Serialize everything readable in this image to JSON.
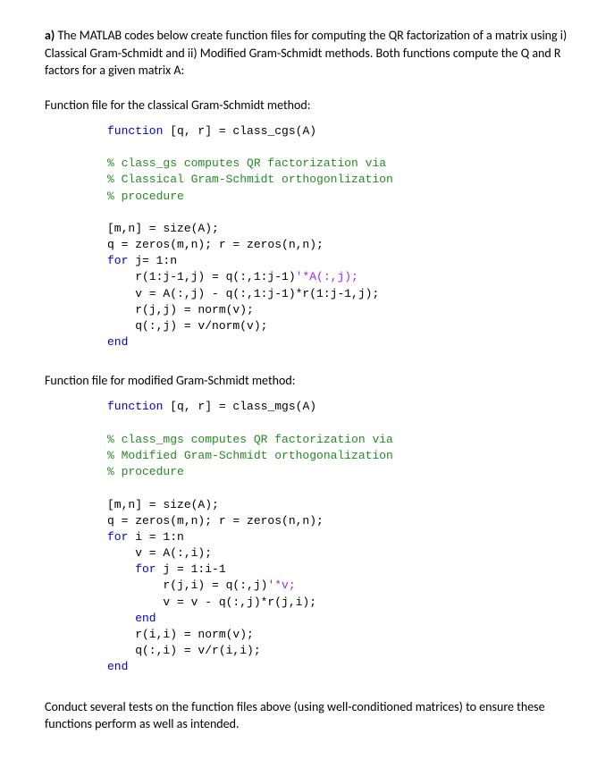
{
  "question": {
    "letter": "a)",
    "text": "The MATLAB codes below create function files for computing the QR factorization of a matrix using i) Classical Gram-Schmidt and ii) Modified Gram-Schmidt methods. Both functions compute the Q and R factors for a given matrix A:"
  },
  "section1": {
    "heading": "Function file for the classical Gram-Schmidt method:",
    "code": {
      "l1a": "function",
      "l1b": " [q, r] = class_cgs(A)",
      "c1": "% class_gs computes QR factorization via",
      "c2": "% Classical Gram-Schmidt orthogonlization",
      "c3": "% procedure",
      "l2": "[m,n] = size(A);",
      "l3": "q = zeros(m,n); r = zeros(n,n);",
      "l4a": "for",
      "l4b": " j= 1:n",
      "l5a": "    r(1:j-1,j) = q(:,1:j-1)",
      "l5b": "'*A(:,j);",
      "l6": "    v = A(:,j) - q(:,1:j-1)*r(1:j-1,j);",
      "l7": "    r(j,j) = norm(v);",
      "l8": "    q(:,j) = v/norm(v);",
      "l9": "end"
    }
  },
  "section2": {
    "heading": "Function file for modified Gram-Schmidt method:",
    "code": {
      "l1a": "function",
      "l1b": " [q, r] = class_mgs(A)",
      "c1": "% class_mgs computes QR factorization via",
      "c2": "% Modified Gram-Schmidt orthogonalization",
      "c3": "% procedure",
      "l2": "[m,n] = size(A);",
      "l3": "q = zeros(m,n); r = zeros(n,n);",
      "l4a": "for",
      "l4b": " i = 1:n",
      "l5": "    v = A(:,i);",
      "l6a": "    for",
      "l6b": " j = 1:i-1",
      "l7a": "        r(j,i) = q(:,j)",
      "l7b": "'*v;",
      "l8": "        v = v - q(:,j)*r(j,i);",
      "l9": "    end",
      "l10": "    r(i,i) = norm(v);",
      "l11": "    q(:,i) = v/r(i,i);",
      "l12": "end"
    }
  },
  "conclusion": "Conduct several tests on the function files above (using well-conditioned matrices) to ensure these functions perform as well as intended."
}
